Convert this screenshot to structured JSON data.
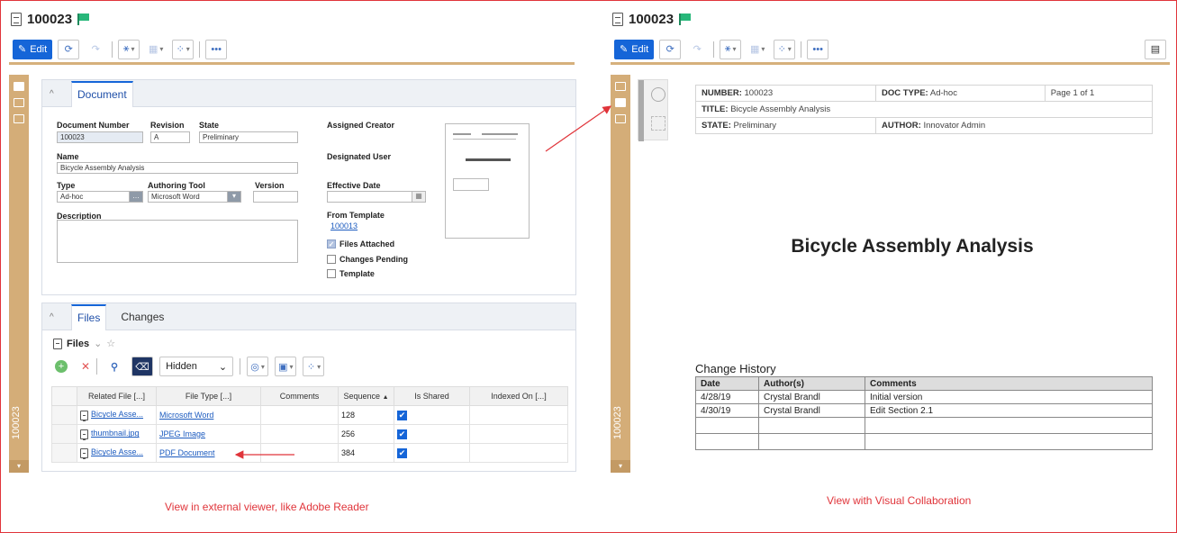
{
  "left": {
    "title": "100023",
    "toolbar": {
      "edit_label": "Edit",
      "more_label": "•••"
    },
    "rail_label": "100023",
    "document_panel": {
      "tab": "Document",
      "fields": {
        "document_number_label": "Document Number",
        "document_number": "100023",
        "revision_label": "Revision",
        "revision": "A",
        "state_label": "State",
        "state": "Preliminary",
        "name_label": "Name",
        "name": "Bicycle Assembly Analysis",
        "type_label": "Type",
        "type": "Ad-hoc",
        "authoring_tool_label": "Authoring Tool",
        "authoring_tool": "Microsoft Word",
        "version_label": "Version",
        "version": "",
        "description_label": "Description",
        "assigned_creator_label": "Assigned Creator",
        "designated_user_label": "Designated User",
        "effective_date_label": "Effective Date",
        "from_template_label": "From Template",
        "from_template": "100013",
        "files_attached": "Files Attached",
        "changes_pending": "Changes Pending",
        "template": "Template"
      }
    },
    "files_panel": {
      "tabs": [
        "Files",
        "Changes"
      ],
      "grid_title": "Files",
      "hidden_select": "Hidden",
      "columns": [
        "Related File [...]",
        "File Type [...]",
        "Comments",
        "Sequence",
        "Is Shared",
        "Indexed On [...]"
      ],
      "rows": [
        {
          "file": "Bicycle Asse...",
          "type": "Microsoft Word",
          "comments": "",
          "sequence": "128",
          "shared": "✔"
        },
        {
          "file": "thumbnail.jpg",
          "type": "JPEG Image",
          "comments": "",
          "sequence": "256",
          "shared": "✔"
        },
        {
          "file": "Bicycle Asse...",
          "type": "PDF Document",
          "comments": "",
          "sequence": "384",
          "shared": "✔"
        }
      ]
    },
    "caption": "View in external viewer, like Adobe Reader"
  },
  "right": {
    "title": "100023",
    "toolbar": {
      "edit_label": "Edit",
      "more_label": "•••"
    },
    "rail_label": "100023",
    "header": {
      "number_label": "NUMBER:",
      "number": "100023",
      "doctype_label": "DOC TYPE:",
      "doctype": "Ad-hoc",
      "page": "Page 1 of 1",
      "title_label": "TITLE:",
      "title": "Bicycle Assembly Analysis",
      "state_label": "STATE:",
      "state": "Preliminary",
      "author_label": "AUTHOR:",
      "author": "Innovator Admin"
    },
    "doc_title": "Bicycle Assembly Analysis",
    "change_history": {
      "heading": "Change History",
      "columns": [
        "Date",
        "Author(s)",
        "Comments"
      ],
      "rows": [
        [
          "4/28/19",
          "Crystal Brandl",
          "Initial version"
        ],
        [
          "4/30/19",
          "Crystal Brandl",
          "Edit Section 2.1"
        ],
        [
          "",
          "",
          ""
        ],
        [
          "",
          "",
          ""
        ]
      ]
    },
    "caption": "View with Visual Collaboration"
  },
  "colors": {
    "accent": "#1565d8",
    "rail": "#d4ad78",
    "annotation": "#e0343a"
  }
}
